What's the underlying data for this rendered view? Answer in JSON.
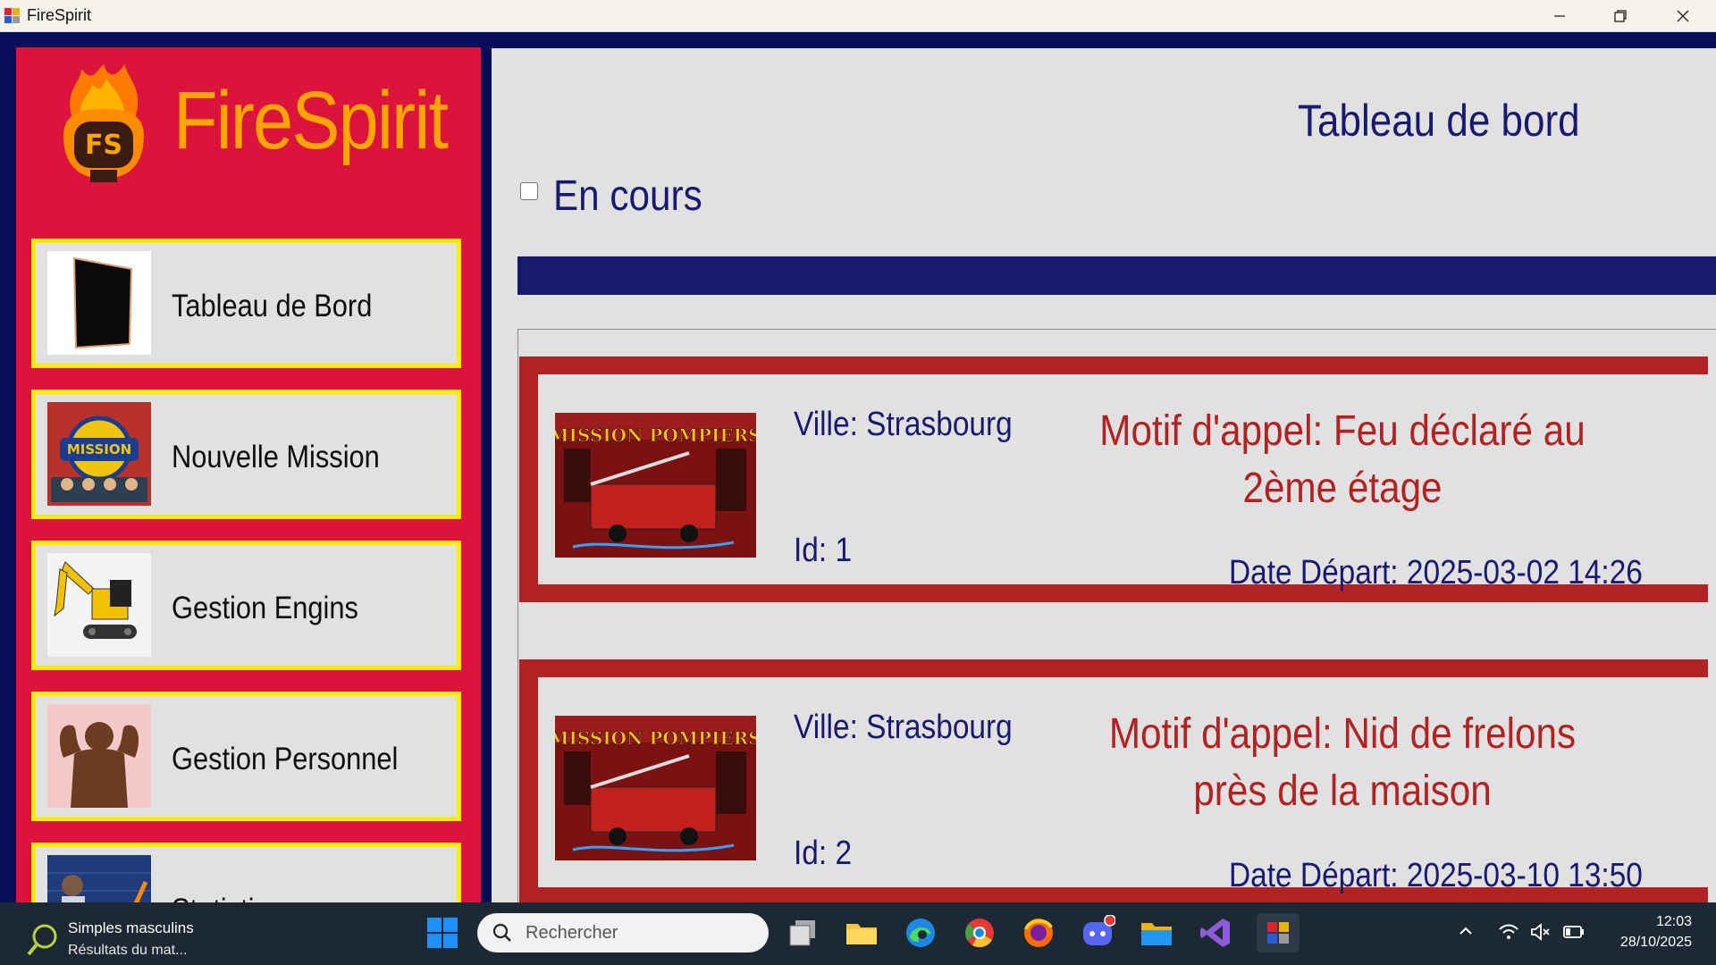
{
  "window": {
    "title": "FireSpirit",
    "minimize_icon": "minimize-icon",
    "restore_icon": "restore-icon",
    "close_icon": "close-icon"
  },
  "sidebar": {
    "logo_badge": "FS",
    "brand": "FireSpirit",
    "items": [
      {
        "label": "Tableau de Bord",
        "icon": "dashboard-panel-image"
      },
      {
        "label": "Nouvelle Mission",
        "icon": "mission-sauvetage-image"
      },
      {
        "label": "Gestion Engins",
        "icon": "excavator-image"
      },
      {
        "label": "Gestion Personnel",
        "icon": "person-flexing-image"
      },
      {
        "label": "Statistiques",
        "icon": "stock-chart-image"
      }
    ]
  },
  "main": {
    "title": "Tableau de bord",
    "filter_label": "En cours",
    "filter_checked": false,
    "missions": [
      {
        "ville": "Ville: Strasbourg",
        "id": "Id: 1",
        "motif": "Motif d'appel: Feu déclaré au 2ème étage",
        "date": "Date Départ: 2025-03-02 14:26",
        "image_text": "MISSION POMPIERS"
      },
      {
        "ville": "Ville: Strasbourg",
        "id": "Id: 2",
        "motif": "Motif d'appel: Nid de frelons près de la maison",
        "date": "Date Départ: 2025-03-10 13:50",
        "image_text": "MISSION POMPIERS"
      }
    ]
  },
  "taskbar": {
    "notification_title": "Simples masculins",
    "notification_subtitle": "Résultats du mat...",
    "search_placeholder": "Rechercher",
    "time": "12:03",
    "date": "28/10/2025",
    "apps": [
      "windows-start-icon",
      "task-view-icon",
      "file-explorer-icon",
      "edge-icon",
      "chrome-icon",
      "firefox-icon",
      "discord-icon",
      "folder-icon",
      "visual-studio-icon",
      "firespirit-app-icon"
    ],
    "tray": [
      "chevron-up-icon",
      "wifi-icon",
      "speaker-muted-icon",
      "battery-icon"
    ]
  },
  "colors": {
    "sidebar_bg": "#dc143c",
    "accent_yellow": "#ffee00",
    "brand_orange": "#ffa500",
    "navy": "#191970",
    "card_red": "#b22222",
    "panel_gray": "#e1e1e1"
  }
}
